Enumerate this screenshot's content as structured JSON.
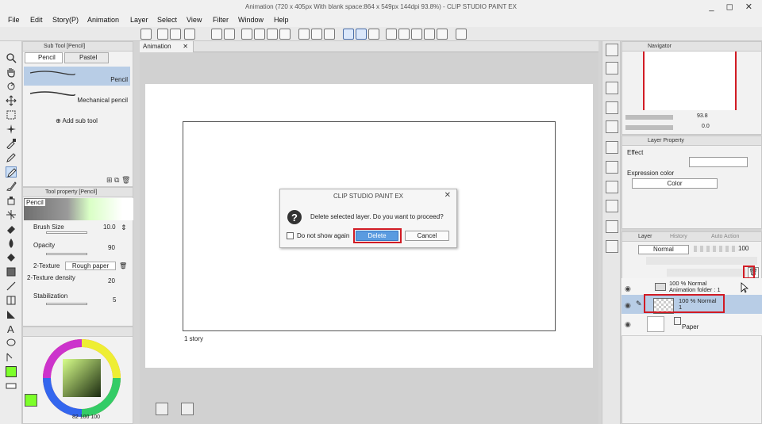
{
  "window": {
    "title": "Animation (720 x 405px With blank space:864 x 549px 144dpi 93.8%)  - CLIP STUDIO PAINT EX",
    "controls": "_ ◻ ✕"
  },
  "menu": [
    "File",
    "Edit",
    "Story(P)",
    "Animation",
    "Layer",
    "Select",
    "View",
    "Filter",
    "Window",
    "Help"
  ],
  "subtool_panel": {
    "header": "Sub Tool [Pencil]",
    "tabs": [
      "Pencil",
      "Pastel"
    ],
    "items": [
      "Pencil",
      "Mechanical pencil"
    ],
    "add_label": "Add sub tool"
  },
  "tool_property": {
    "header": "Tool property [Pencil]",
    "tool_name": "Pencil",
    "brush_size": {
      "label": "Brush Size",
      "value": "10.0"
    },
    "opacity": {
      "label": "Opacity",
      "value": "90"
    },
    "texture": {
      "label": "2-Texture",
      "value": "Rough paper"
    },
    "texture_density": {
      "label": "2-Texture density",
      "value": "20"
    },
    "stabilization": {
      "label": "Stabilization",
      "value": "5"
    }
  },
  "color_panel": {
    "readout": "82  100  100",
    "main_color": "#7dff2a"
  },
  "canvas": {
    "tab_label": "Animation",
    "story_label": "1 story"
  },
  "dialog": {
    "title": "CLIP STUDIO PAINT EX",
    "message": "Delete selected layer. Do you want to proceed?",
    "checkbox_label": "Do not show again",
    "delete_label": "Delete",
    "cancel_label": "Cancel"
  },
  "navigator": {
    "header": "Navigator",
    "zoom": "93.8",
    "rotation": "0.0"
  },
  "layer_property": {
    "header": "Layer Property",
    "effect_label": "Effect",
    "expression_label": "Expression color",
    "expression_value": "Color"
  },
  "layer_panel": {
    "tabs": [
      "Layer",
      "History",
      "Auto Action"
    ],
    "blend_mode": "Normal",
    "opacity": "100",
    "layers": [
      {
        "line1": "100 % Normal",
        "line2": "Animation folder : 1"
      },
      {
        "line1": "100 % Normal",
        "line2": "1"
      },
      {
        "line1": "Paper",
        "line2": ""
      }
    ]
  },
  "colors": {
    "accent_red": "#d11b24",
    "selection_blue": "#b8cde6",
    "primary_button": "#5a9be0"
  }
}
